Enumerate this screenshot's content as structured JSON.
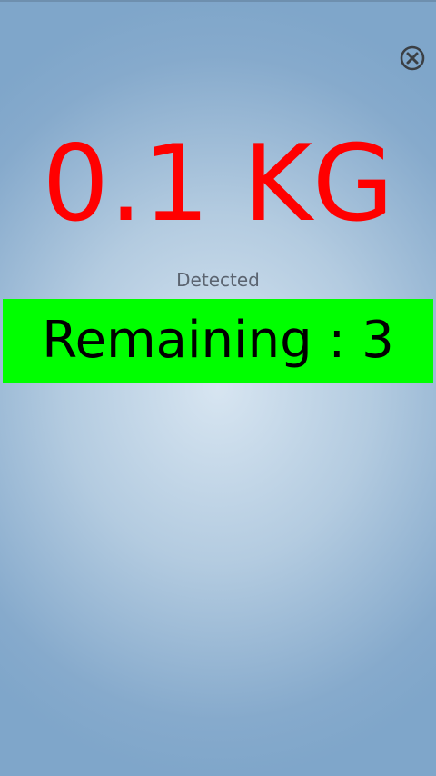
{
  "screen": {
    "weight_display": "0.1 KG",
    "status_label": "Detected",
    "remaining_label": "Remaining : 3"
  },
  "controls": {
    "close_icon": "close-icon"
  },
  "colors": {
    "weight_text": "#ff0000",
    "remaining_bar": "#00ff00",
    "remaining_text": "#000000",
    "status_text": "#5b6470"
  }
}
